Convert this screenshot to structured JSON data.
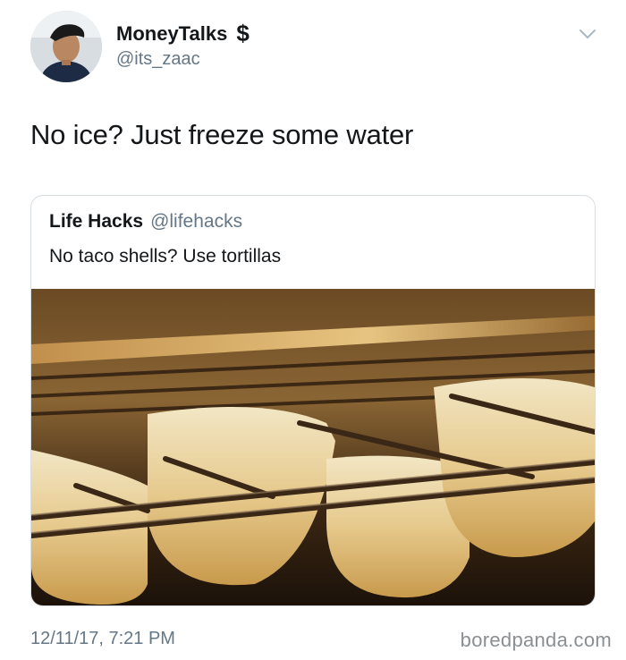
{
  "tweet": {
    "author": {
      "display_name": "MoneyTalks",
      "name_emoji": "$",
      "handle": "@its_zaac",
      "avatar_icon": "profile-photo-icon"
    },
    "menu_icon": "chevron-down-icon",
    "text": "No ice? Just freeze some water",
    "timestamp": "12/11/17, 7:21 PM"
  },
  "quoted_tweet": {
    "display_name": "Life Hacks",
    "handle": "@lifehacks",
    "text": "No taco shells? Use tortillas",
    "image": "tortillas-draped-over-oven-rack"
  },
  "watermark": "boredpanda.com",
  "colors": {
    "primary_text": "#14171a",
    "secondary_text": "#657786",
    "border": "#d6dde3"
  }
}
